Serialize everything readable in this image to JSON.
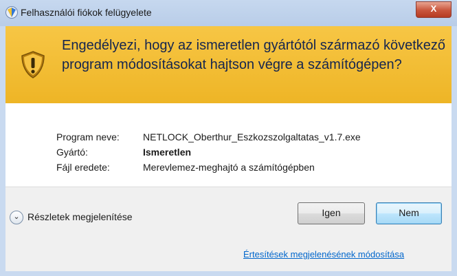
{
  "window": {
    "title": "Felhasználói fiókok felügyelete",
    "close_label": "X"
  },
  "banner": {
    "question": "Engedélyezi, hogy az ismeretlen gyártótól származó következő program módosításokat hajtson végre a számítógépen?"
  },
  "details": {
    "rows": [
      {
        "label": "Program neve:",
        "value": "NETLOCK_Oberthur_Eszkozszolgaltatas_v1.7.exe"
      },
      {
        "label": "Gyártó:",
        "value": "Ismeretlen"
      },
      {
        "label": "Fájl eredete:",
        "value": "Merevlemez-meghajtó a számítógépben"
      }
    ]
  },
  "footer": {
    "show_details_label": "Részletek megjelenítése",
    "yes_label": "Igen",
    "no_label": "Nem",
    "notification_link": "Értesítések megjelenésének módosítása"
  },
  "colors": {
    "banner": "#f3bd36",
    "link": "#0066cc"
  }
}
